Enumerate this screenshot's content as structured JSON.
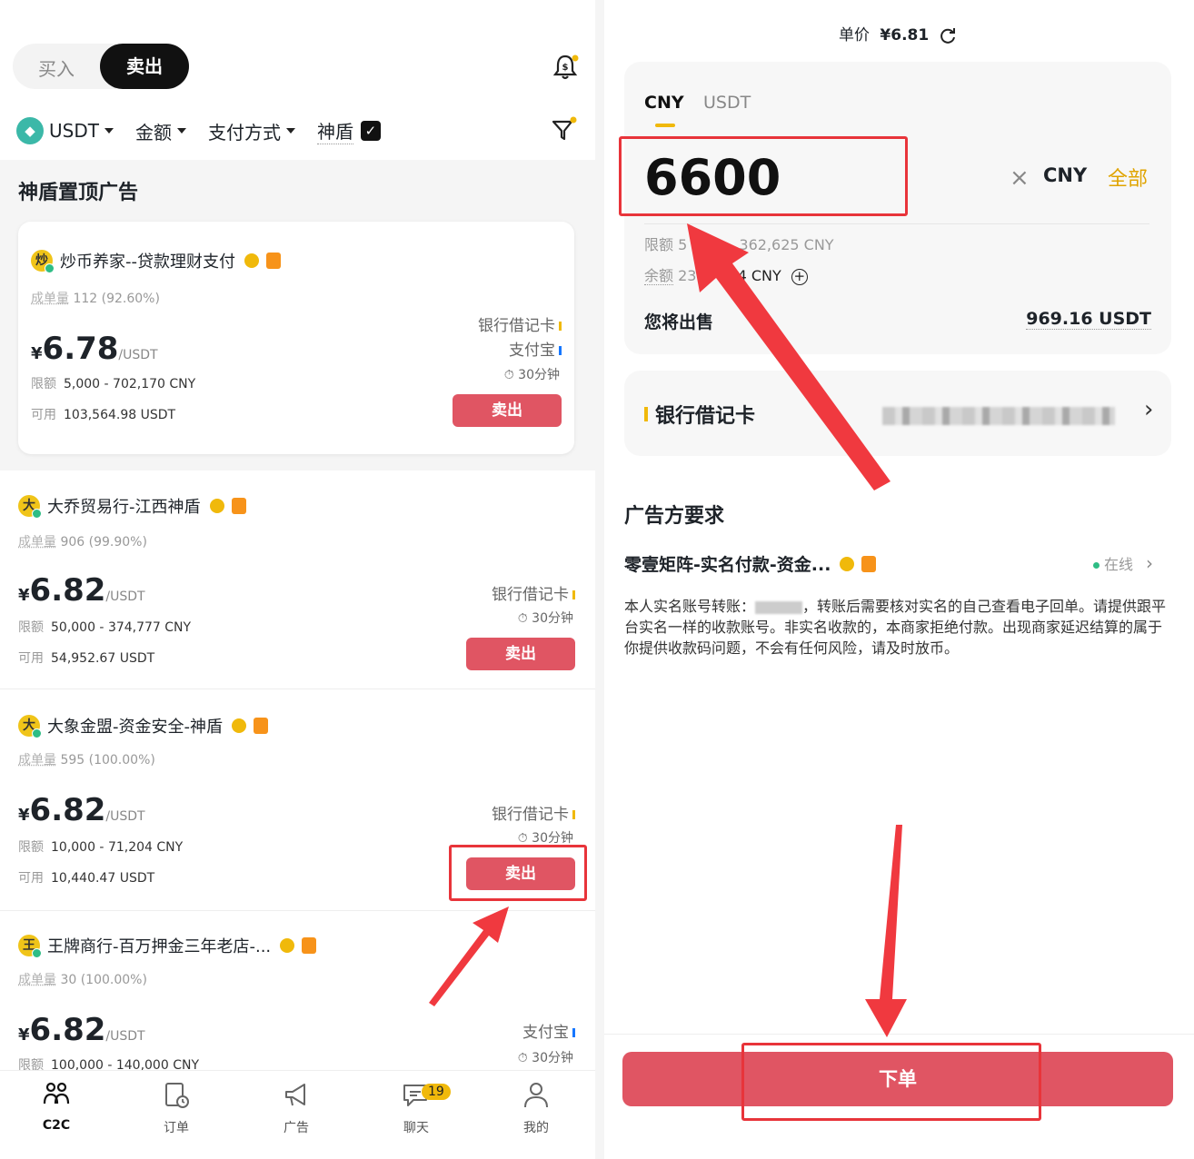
{
  "left": {
    "top_cut_text": "...",
    "segment": {
      "buy": "买入",
      "sell": "卖出"
    },
    "filters": {
      "coin": "USDT",
      "amount": "金额",
      "payment": "支付方式",
      "shield": "神盾"
    },
    "section_title": "神盾置顶广告",
    "ads": [
      {
        "avatar": "炒",
        "name": "炒币养家--贷款理财支付",
        "trades_label": "成单量",
        "trades_value": "112 (92.60%)",
        "currency_sign": "¥",
        "price": "6.78",
        "price_unit": "/USDT",
        "limit_label": "限额",
        "limit": "5,000 - 702,170 CNY",
        "avail_label": "可用",
        "avail": "103,564.98 USDT",
        "payments": [
          "银行借记卡",
          "支付宝"
        ],
        "time": "30分钟",
        "button": "卖出"
      },
      {
        "avatar": "大",
        "name": "大乔贸易行-江西神盾",
        "trades_label": "成单量",
        "trades_value": "906 (99.90%)",
        "currency_sign": "¥",
        "price": "6.82",
        "price_unit": "/USDT",
        "limit_label": "限额",
        "limit": "50,000 - 374,777 CNY",
        "avail_label": "可用",
        "avail": "54,952.67 USDT",
        "payments": [
          "银行借记卡"
        ],
        "time": "30分钟",
        "button": "卖出"
      },
      {
        "avatar": "大",
        "name": "大象金盟-资金安全-神盾",
        "trades_label": "成单量",
        "trades_value": "595 (100.00%)",
        "currency_sign": "¥",
        "price": "6.82",
        "price_unit": "/USDT",
        "limit_label": "限额",
        "limit": "10,000 - 71,204 CNY",
        "avail_label": "可用",
        "avail": "10,440.47 USDT",
        "payments": [
          "银行借记卡"
        ],
        "time": "30分钟",
        "button": "卖出"
      },
      {
        "avatar": "王",
        "name": "王牌商行-百万押金三年老店-...",
        "trades_label": "成单量",
        "trades_value": "30 (100.00%)",
        "currency_sign": "¥",
        "price": "6.82",
        "price_unit": "/USDT",
        "limit_label": "限额",
        "limit": "100,000 - 140,000 CNY",
        "payments": [
          "支付宝"
        ],
        "time": "30分钟"
      }
    ],
    "tabbar": [
      {
        "label": "C2C",
        "icon": "c2c-icon"
      },
      {
        "label": "订单",
        "icon": "order-icon"
      },
      {
        "label": "广告",
        "icon": "megaphone-icon"
      },
      {
        "label": "聊天",
        "icon": "chat-icon",
        "badge": "19"
      },
      {
        "label": "我的",
        "icon": "user-icon"
      }
    ]
  },
  "right": {
    "unit_price_label": "单价",
    "unit_price": "¥6.81",
    "tabs": {
      "cny": "CNY",
      "usdt": "USDT"
    },
    "amount": "6600",
    "clear": "×",
    "currency": "CNY",
    "all": "全部",
    "limit_label": "限额",
    "limit_partial": "5",
    "limit_tail": "362,625 CNY",
    "balance_label": "余额",
    "balance_partial": "23",
    "balance_tail": "4 CNY",
    "will_sell_label": "您将出售",
    "will_sell_value": "969.16 USDT",
    "payment_method": "银行借记卡",
    "requirements_title": "广告方要求",
    "merchant_name": "零壹矩阵-实名付款-资金...",
    "online": "在线",
    "remark_part1": "本人实名账号转账：",
    "remark_part2": "，转账后需要核对实名的自己查看电子回单。请提供跟平台实名一样的收款账号。非实名收款的，本商家拒绝付款。出现商家延迟结算的属于你提供收款码问题，不会有任何风险，请及时放币。",
    "order_button": "下单"
  },
  "colors": {
    "accent": "#f0b90b",
    "sell": "#e05563",
    "annotation": "#e8343a"
  }
}
